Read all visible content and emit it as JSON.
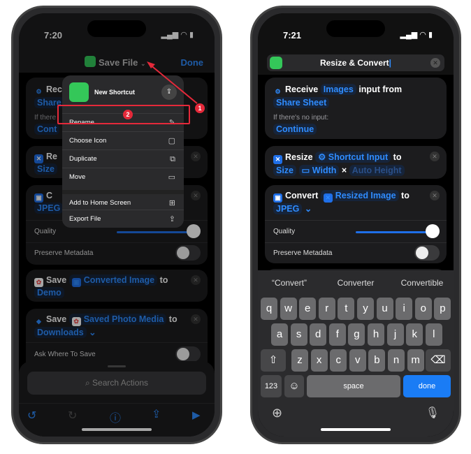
{
  "left": {
    "status": {
      "time": "7:20",
      "icons": "wifi-battery"
    },
    "nav": {
      "title": "Save File",
      "done": "Done"
    },
    "actions": {
      "receive": {
        "verb": "Rece",
        "token": "Share",
        "sub": "If there",
        "cont": "Cont"
      },
      "resize": {
        "verb": "Re",
        "token": "Size"
      },
      "convert": {
        "verb": "C",
        "token": "JPEG",
        "quality": "Quality",
        "preserve": "Preserve Metadata"
      },
      "save1": {
        "verb": "Save",
        "token": "Converted Image",
        "to": "to",
        "dest": "Demo"
      },
      "save2": {
        "verb": "Save",
        "token": "Saved Photo Media",
        "to": "to",
        "dest": "Downloads",
        "ask": "Ask Where To Save"
      }
    },
    "menu": {
      "name": "New Shortcut",
      "items": [
        {
          "label": "Rename",
          "icon": "pencil-icon"
        },
        {
          "label": "Choose Icon",
          "icon": "square-icon"
        },
        {
          "label": "Duplicate",
          "icon": "duplicate-icon"
        },
        {
          "label": "Move",
          "icon": "folder-icon"
        },
        {
          "label": "Add to Home Screen",
          "icon": "plus-square-icon"
        },
        {
          "label": "Export File",
          "icon": "share-icon"
        }
      ]
    },
    "search": {
      "placeholder": "Search Actions"
    },
    "annotations": {
      "one": "1",
      "two": "2"
    },
    "colors": {
      "accent": "#2f8cff",
      "annotation": "#e5293a",
      "green": "#34c759"
    }
  },
  "right": {
    "status": {
      "time": "7:21"
    },
    "title": "Resize & Convert",
    "receive": {
      "verb": "Receive",
      "token": "Images",
      "rest": "input from",
      "src": "Share Sheet",
      "sub": "If there's no input:",
      "cont": "Continue"
    },
    "resize": {
      "verb": "Resize",
      "token": "Shortcut Input",
      "to": "to",
      "size": "Size",
      "width": "Width",
      "x": "×",
      "height": "Auto Height"
    },
    "convert": {
      "verb": "Convert",
      "token": "Resized Image",
      "to": "to",
      "fmt": "JPEG",
      "quality": "Quality",
      "preserve": "Preserve Metadata"
    },
    "suggestions": [
      "“Convert”",
      "Converter",
      "Convertible"
    ],
    "keyboard": {
      "row1": [
        "q",
        "w",
        "e",
        "r",
        "t",
        "y",
        "u",
        "i",
        "o",
        "p"
      ],
      "row2": [
        "a",
        "s",
        "d",
        "f",
        "g",
        "h",
        "j",
        "k",
        "l"
      ],
      "row3": [
        "z",
        "x",
        "c",
        "v",
        "b",
        "n",
        "m"
      ],
      "num": "123",
      "space": "space",
      "done": "done"
    }
  }
}
